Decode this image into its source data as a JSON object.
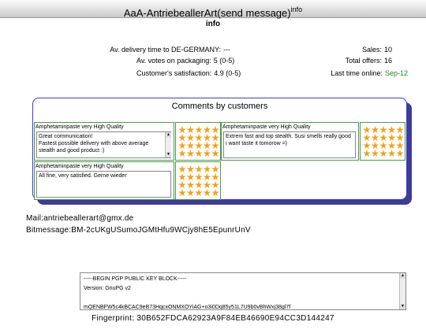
{
  "title": {
    "text": "AaA-AntriebeallerArt(send message)",
    "sup": "info"
  },
  "subtitle": "info",
  "stats_left": [
    {
      "label": "Av. delivery time to DE-GERMANY:",
      "value": "---"
    },
    {
      "label": "Av. votes on packaging:",
      "value": "5 (0-5)"
    },
    {
      "label": "Customer's satisfaction:",
      "value": "4.9 (0-5)"
    }
  ],
  "stats_right": [
    {
      "label": "Sales:",
      "value": "10"
    },
    {
      "label": "Total offers:",
      "value": "16"
    },
    {
      "label": "Last time online:",
      "value": "Sep-12",
      "color": "#1b8a1b"
    }
  ],
  "comments_title": "Comments by customers",
  "comments": [
    {
      "product": "Amphetaminpaste very High Quality",
      "text": "Great communication!\nFastest possible delivery with above average stealth and good product :)",
      "rating": 5
    },
    {
      "product": "Amphetaminpaste very High Quality",
      "text": "Extrem fast and top stealth. Susi smells really good i want taste it tomorow =)",
      "rating": 5
    },
    {
      "product": "Amphetaminpaste very High Quality",
      "text": "All fine, very satisfied. Gerne wieder",
      "rating": 5
    }
  ],
  "contact": {
    "mail": "Mail:antriebeallerart@gmx.de",
    "bitmessage": "Bitmessage:BM-2cUKgUSumoJGMtHfu9WCjy8hE5EpunrUnV"
  },
  "pgp": {
    "text": "-----BEGIN PGP PUBLIC KEY BLOCK-----\nVersion: GnuPG v2\n\nmQENBFW5c4kBCAC9eB73HqcxONMXOYiAG+o3i0Dq85y51L7U9b0vBhWxj38gl7f"
  },
  "fingerprint": "Fingerprint: 30B652FDCA62923A9F84EB46690E94CC3D144247"
}
